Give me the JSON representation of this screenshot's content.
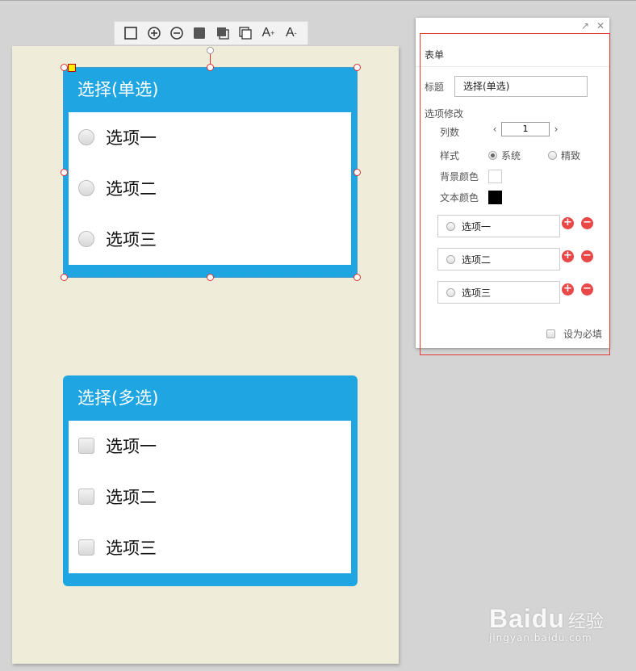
{
  "toolbar": {
    "buttons": [
      {
        "name": "square-outline-icon"
      },
      {
        "name": "zoom-in-icon"
      },
      {
        "name": "zoom-out-icon"
      },
      {
        "name": "fill-square-icon"
      },
      {
        "name": "bring-front-icon"
      },
      {
        "name": "send-back-icon"
      }
    ],
    "font_increase_label": "A",
    "font_increase_sup": "+",
    "font_decrease_label": "A",
    "font_decrease_sup": "-"
  },
  "radio_card": {
    "title": "选择(单选)",
    "options": [
      "选项一",
      "选项二",
      "选项三"
    ]
  },
  "check_card": {
    "title": "选择(多选)",
    "options": [
      "选项一",
      "选项二",
      "选项三"
    ]
  },
  "colors": {
    "card_blue": "#1fa6e2",
    "canvas_bg": "#efedda",
    "accent_red": "#e84848"
  },
  "panel": {
    "header": "表单",
    "expand_icon": "↗",
    "close_icon": "✕",
    "title_label": "标题",
    "title_value": "选择(单选)",
    "section_options": "选项修改",
    "columns_label": "列数",
    "columns_value": "1",
    "columns_prev": "‹",
    "columns_next": "›",
    "style_label": "样式",
    "style_options": [
      {
        "label": "系统",
        "selected": true
      },
      {
        "label": "精致",
        "selected": false
      }
    ],
    "bg_color_label": "背景颜色",
    "bg_color_value": "#ffffff",
    "text_color_label": "文本颜色",
    "text_color_value": "#000000",
    "option_items": [
      "选项一",
      "选项二",
      "选项三"
    ],
    "add_symbol": "+",
    "remove_symbol": "−",
    "required_label": "设为必填"
  },
  "watermark": {
    "logo": "Baidu",
    "suffix": "经验",
    "url": "jingyan.baidu.com"
  }
}
